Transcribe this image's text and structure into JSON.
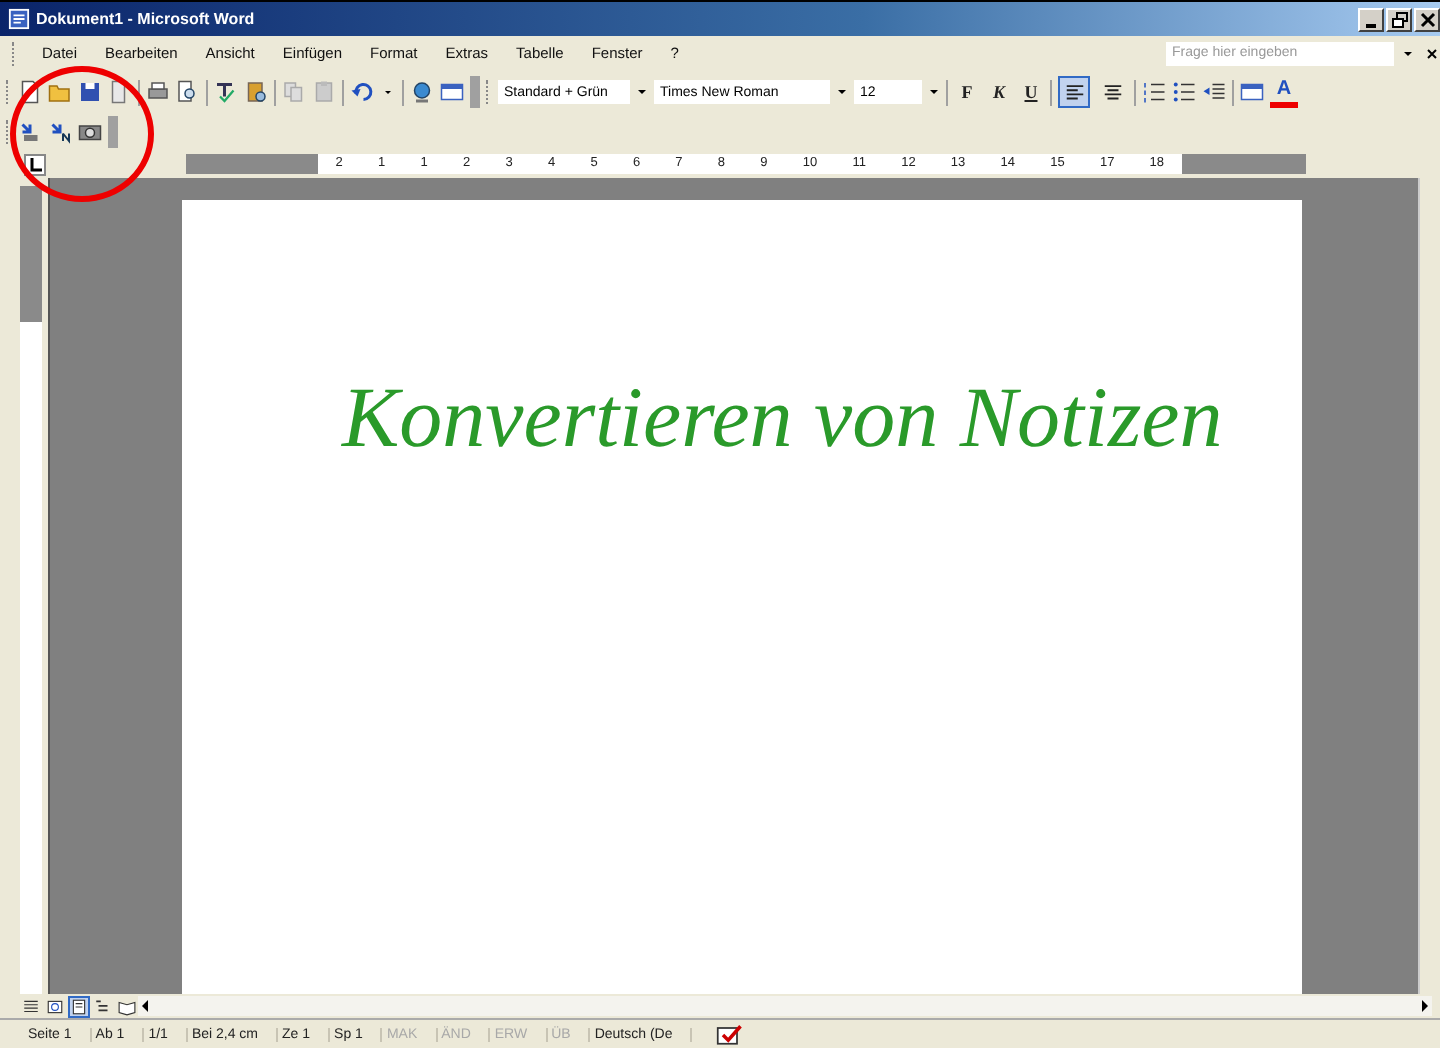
{
  "window": {
    "title": "Dokument1 - Microsoft Word"
  },
  "menu": [
    "Datei",
    "Bearbeiten",
    "Ansicht",
    "Einfügen",
    "Format",
    "Extras",
    "Tabelle",
    "Fenster",
    "?"
  ],
  "help_field": {
    "placeholder": "Frage hier eingeben"
  },
  "toolbar": {
    "tools": [
      {
        "kind": "new"
      },
      {
        "kind": "open"
      },
      {
        "kind": "save"
      },
      {
        "kind": "permission"
      },
      {
        "kind": "sep"
      },
      {
        "kind": "print"
      },
      {
        "kind": "preview"
      },
      {
        "kind": "sep"
      },
      {
        "kind": "spell"
      },
      {
        "kind": "research"
      },
      {
        "kind": "sep"
      },
      {
        "kind": "copy"
      },
      {
        "kind": "paste"
      },
      {
        "kind": "sep"
      },
      {
        "kind": "undo"
      },
      {
        "kind": "dropdown"
      },
      {
        "kind": "sep"
      },
      {
        "kind": "globe"
      },
      {
        "kind": "table"
      }
    ],
    "style": "Standard + Grün",
    "font": "Times New Roman",
    "size": "12",
    "format_buttons": [
      {
        "label": "F",
        "kind": "bold"
      },
      {
        "label": "K",
        "kind": "italic"
      },
      {
        "label": "U",
        "kind": "underline"
      }
    ],
    "align_buttons": [
      {
        "kind": "left",
        "selected": true
      },
      {
        "kind": "center",
        "selected": false
      }
    ],
    "list_tools": [
      {
        "kind": "numbered"
      },
      {
        "kind": "bullets"
      },
      {
        "kind": "indent"
      }
    ],
    "font_color": "A"
  },
  "ink_toolbar": {
    "tools": [
      {
        "kind": "convert"
      },
      {
        "kind": "convert-text"
      },
      {
        "kind": "camera"
      }
    ]
  },
  "ruler": {
    "labels": [
      "2",
      "1",
      "1",
      "2",
      "3",
      "4",
      "5",
      "6",
      "7",
      "8",
      "9",
      "10",
      "11",
      "12",
      "13",
      "14",
      "15",
      "17",
      "18"
    ]
  },
  "document": {
    "text": "Konvertieren von Notizen"
  },
  "views": [
    {
      "kind": "normal",
      "selected": false
    },
    {
      "kind": "web",
      "selected": false
    },
    {
      "kind": "print",
      "selected": true
    },
    {
      "kind": "outline",
      "selected": false
    },
    {
      "kind": "reading",
      "selected": false
    }
  ],
  "status_bar": [
    {
      "text": "Seite 1",
      "disabled": false
    },
    {
      "text": "Ab 1",
      "disabled": false
    },
    {
      "text": "1/1",
      "disabled": false
    },
    {
      "text": "Bei 2,4 cm",
      "disabled": false
    },
    {
      "text": "Ze 1",
      "disabled": false
    },
    {
      "text": "Sp 1",
      "disabled": false
    },
    {
      "text": "MAK",
      "disabled": true
    },
    {
      "text": "ÄND",
      "disabled": true
    },
    {
      "text": "ERW",
      "disabled": true
    },
    {
      "text": "ÜB",
      "disabled": true
    },
    {
      "text": "Deutsch (De",
      "disabled": false
    }
  ],
  "annotations": [
    {
      "kind": "circle"
    }
  ]
}
